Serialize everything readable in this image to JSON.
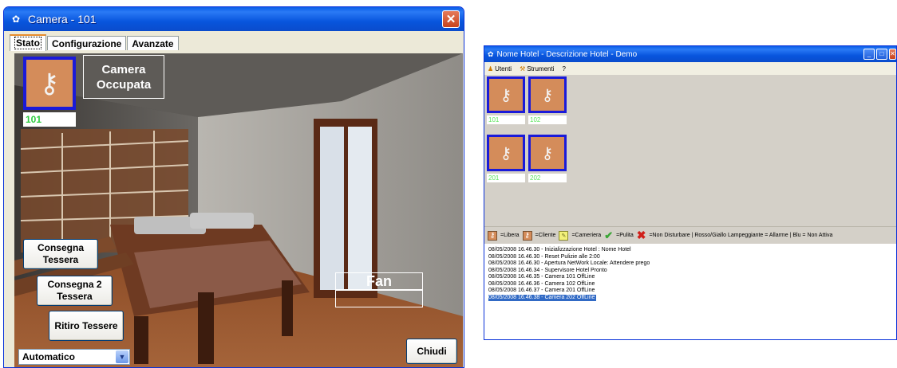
{
  "window1": {
    "title": "Camera - 101",
    "close_glyph": "✕",
    "tabs": [
      "Stato",
      "Configurazione",
      "Avanzate"
    ],
    "room_number": "101",
    "status_line1": "Camera",
    "status_line2": "Occupata",
    "buttons": {
      "consegna1_line1": "Consegna",
      "consegna1_line2": "Tessera",
      "consegna2_line1": "Consegna 2",
      "consegna2_line2": "Tessera",
      "ritiro": "Ritiro Tessere",
      "chiudi": "Chiudi"
    },
    "fan_label": "Fan",
    "mode_select": "Automatico",
    "colors": {
      "key_blue": "#1a1ad9",
      "key_bg": "#d48c5a",
      "room_num_green": "#2ecc40"
    }
  },
  "window2": {
    "title": "Nome Hotel - Descrizione Hotel - Demo",
    "menu": [
      "Utenti",
      "Strumenti",
      "?"
    ],
    "rooms": [
      "101",
      "102",
      "201",
      "202"
    ],
    "legend": {
      "libera": "=Libera",
      "cliente": "=Cliente",
      "cameriera": "=Cameriera",
      "pulita": "=Pulita",
      "rest": "=Non Disturbare | Rosso/Giallo Lampeggiante = Allarme | Blu = Non Attiva"
    },
    "log": [
      "08/05/2008 16.46.30 - Inizializzazione Hotel  : Nome Hotel",
      "08/05/2008 16.46.30 - Reset Pulizie alle 2:00",
      "08/05/2008 16.46.30 - Apertura NetWork Locale: Attendere prego",
      "08/05/2008 16.46.34 - Supervisore Hotel Pronto",
      "08/05/2008 16.46.35 - Camera 101 OffLine",
      "08/05/2008 16.46.36 - Camera 102 OffLine",
      "08/05/2008 16.46.37 - Camera 201 OffLine",
      "08/05/2008 16.46.38 - Camera 202 OffLine"
    ]
  }
}
